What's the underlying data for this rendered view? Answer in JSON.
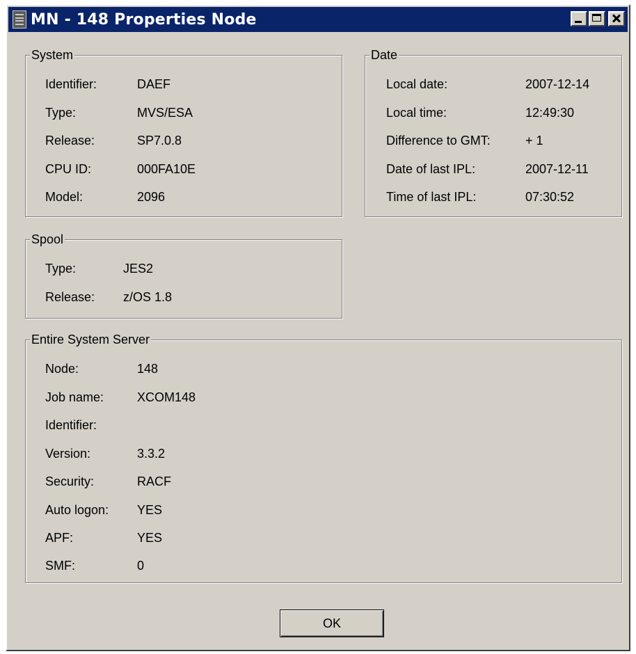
{
  "window": {
    "title": "MN - 148 Properties Node",
    "controls": [
      "minimize",
      "maximize",
      "close"
    ]
  },
  "system": {
    "legend": "System",
    "rows": [
      {
        "label": "Identifier:",
        "value": "DAEF"
      },
      {
        "label": "Type:",
        "value": "MVS/ESA"
      },
      {
        "label": "Release:",
        "value": "SP7.0.8"
      },
      {
        "label": "CPU ID:",
        "value": "000FA10E"
      },
      {
        "label": "Model:",
        "value": "2096"
      }
    ]
  },
  "date": {
    "legend": "Date",
    "rows": [
      {
        "label": "Local date:",
        "value": "2007-12-14"
      },
      {
        "label": "Local time:",
        "value": "12:49:30"
      },
      {
        "label": "Difference to GMT:",
        "value": "+ 1"
      },
      {
        "label": "Date of last IPL:",
        "value": "2007-12-11"
      },
      {
        "label": "Time of last IPL:",
        "value": "07:30:52"
      }
    ]
  },
  "spool": {
    "legend": "Spool",
    "rows": [
      {
        "label": "Type:",
        "value": "JES2"
      },
      {
        "label": "Release:",
        "value": "z/OS 1.8"
      }
    ]
  },
  "server": {
    "legend": "Entire System Server",
    "rows": [
      {
        "label": "Node:",
        "value": "148"
      },
      {
        "label": "Job name:",
        "value": "XCOM148"
      },
      {
        "label": "Identifier:",
        "value": ""
      },
      {
        "label": "Version:",
        "value": "3.3.2"
      },
      {
        "label": "Security:",
        "value": "RACF"
      },
      {
        "label": "Auto logon:",
        "value": "YES"
      },
      {
        "label": "APF:",
        "value": "YES"
      },
      {
        "label": "SMF:",
        "value": "0"
      }
    ]
  },
  "buttons": {
    "ok": "OK"
  },
  "icons": {
    "app": "node-properties-icon",
    "minimize": "minimize-icon",
    "maximize": "maximize-icon",
    "close": "close-icon"
  }
}
